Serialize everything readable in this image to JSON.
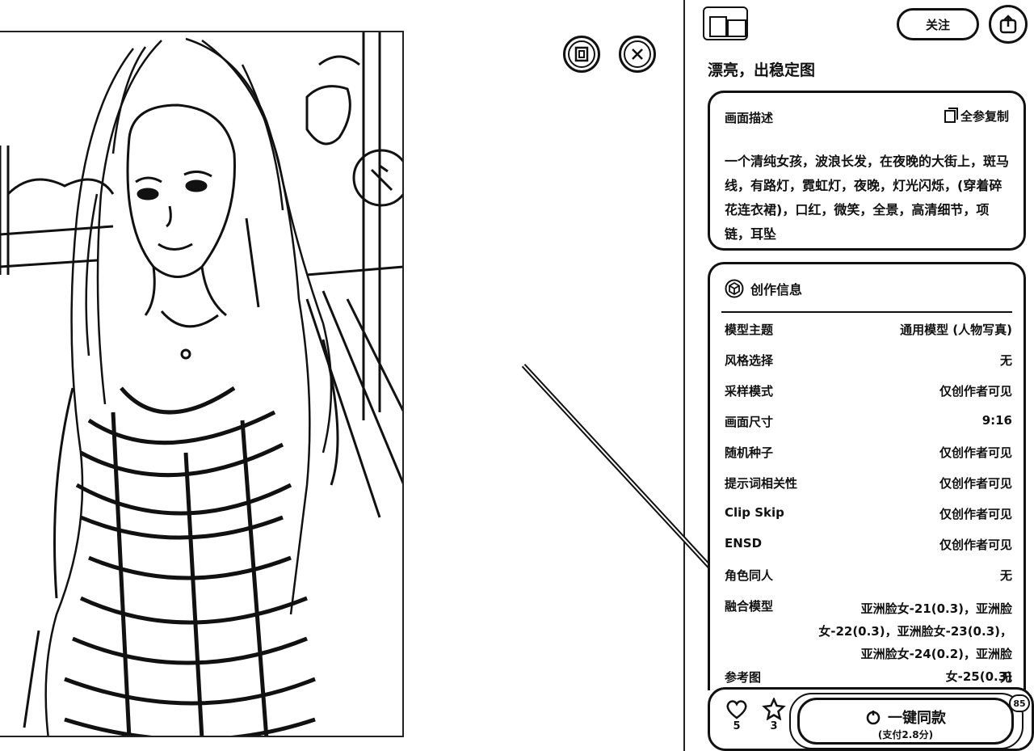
{
  "viewer": {
    "download_icon": "download-icon",
    "close_icon": "close-icon"
  },
  "author": {
    "name": "",
    "follow_label": "关注"
  },
  "work": {
    "title": "漂亮，出稳定图"
  },
  "prompt_card": {
    "label": "画面描述",
    "copy_all_label": "全参复制",
    "text": "一个清纯女孩，波浪长发，在夜晚的大街上，斑马线，有路灯，霓虹灯，夜晚，灯光闪烁，(穿着碎花连衣裙)，口红，微笑，全景，高清细节，项链，耳坠"
  },
  "info_card": {
    "title": "创作信息",
    "rows": [
      {
        "key": "模型主题",
        "value": "通用模型 (人物写真)"
      },
      {
        "key": "风格选择",
        "value": "无"
      },
      {
        "key": "采样模式",
        "value": "仅创作者可见"
      },
      {
        "key": "画面尺寸",
        "value": "9:16"
      },
      {
        "key": "随机种子",
        "value": "仅创作者可见"
      },
      {
        "key": "提示词相关性",
        "value": "仅创作者可见"
      },
      {
        "key": "Clip Skip",
        "value": "仅创作者可见"
      },
      {
        "key": "ENSD",
        "value": "仅创作者可见"
      },
      {
        "key": "角色同人",
        "value": "无"
      },
      {
        "key": "融合模型",
        "value": "亚洲脸女-21(0.3)，亚洲脸女-22(0.3)，亚洲脸女-23(0.3)，亚洲脸女-24(0.2)，亚洲脸女-25(0.3)"
      },
      {
        "key": "参考图",
        "value": "无"
      }
    ]
  },
  "actions": {
    "like_count": "5",
    "star_count": "3",
    "same_style_label": "一键同款",
    "same_style_price": "(支付2.8分)",
    "badge": "85"
  },
  "colors": {
    "ink": "#111111",
    "background": "#ffffff"
  }
}
